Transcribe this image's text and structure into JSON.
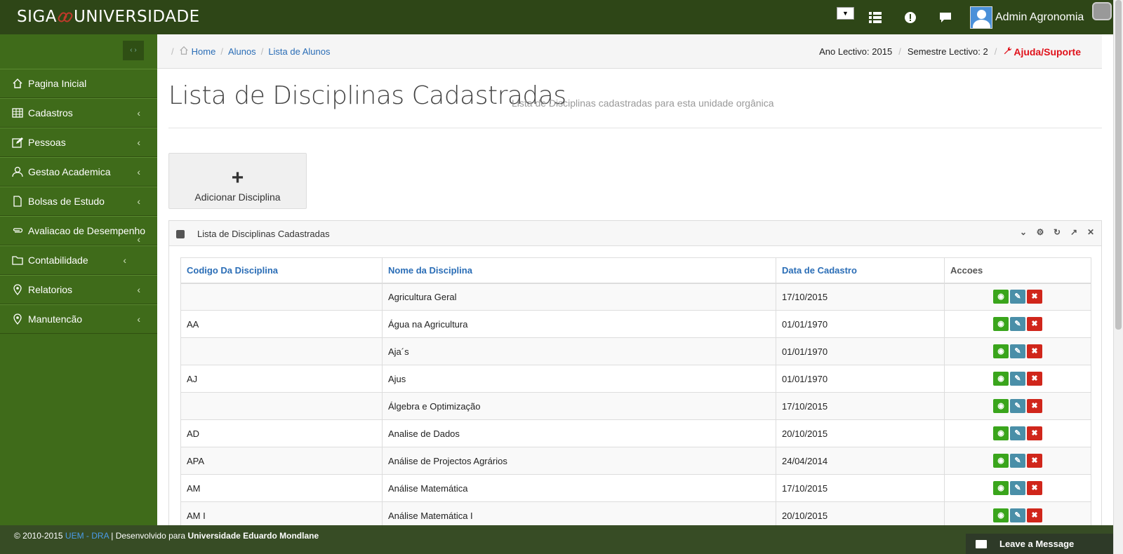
{
  "app": {
    "brand_left": "SIGA",
    "brand_right": "UNIVERSIDADE",
    "user_name": "Admin Agronomia",
    "dropdown_value": "▼"
  },
  "sidebar": {
    "items": [
      {
        "label": "Pagina Inicial",
        "icon": "home-icon"
      },
      {
        "label": "Cadastros",
        "icon": "table-icon"
      },
      {
        "label": "Pessoas",
        "icon": "edit-icon"
      },
      {
        "label": "Gestao Academica",
        "icon": "user-icon"
      },
      {
        "label": "Bolsas de Estudo",
        "icon": "file-icon"
      },
      {
        "label": "Avaliacao de Desempenho",
        "icon": "paperclip-icon"
      },
      {
        "label": "Contabilidade",
        "icon": "folder-icon"
      },
      {
        "label": "Relatorios",
        "icon": "map-pin-icon"
      },
      {
        "label": "Manutencão",
        "icon": "map-pin-icon"
      }
    ]
  },
  "breadcrumb": {
    "home": "Home",
    "alunos": "Alunos",
    "lista": "Lista de Alunos"
  },
  "period": {
    "ano": "Ano Lectivo: 2015",
    "semestre": "Semestre Lectivo: 2",
    "help": "Ajuda/Suporte"
  },
  "page": {
    "title": "Lista de Disciplinas Cadastradas",
    "subtitle": "Lista de Disciplinas cadastradas para esta unidade orgânica",
    "add_button": "Adicionar Disciplina"
  },
  "panel": {
    "title": "Lista de Disciplinas Cadastradas",
    "columns": [
      "Codigo Da Disciplina",
      "Nome da Disciplina",
      "Data de Cadastro",
      "Accoes"
    ],
    "rows": [
      {
        "codigo": "",
        "nome": "Agricultura Geral",
        "data": "17/10/2015"
      },
      {
        "codigo": "AA",
        "nome": "Água na Agricultura",
        "data": "01/01/1970"
      },
      {
        "codigo": "",
        "nome": "Aja´s",
        "data": "01/01/1970"
      },
      {
        "codigo": "AJ",
        "nome": "Ajus",
        "data": "01/01/1970"
      },
      {
        "codigo": "",
        "nome": "Álgebra e Optimização",
        "data": "17/10/2015"
      },
      {
        "codigo": "AD",
        "nome": "Analise de Dados",
        "data": "20/10/2015"
      },
      {
        "codigo": "APA",
        "nome": "Análise de Projectos Agrários",
        "data": "24/04/2014"
      },
      {
        "codigo": "AM",
        "nome": "Análise Matemática",
        "data": "17/10/2015"
      },
      {
        "codigo": "AM I",
        "nome": "Análise Matemática I",
        "data": "20/10/2015"
      }
    ]
  },
  "footer": {
    "copyright": "© 2010-2015",
    "org": "UEM - DRA",
    "dev": "| Desenvolvido para",
    "univ": "Universidade Eduardo Mondlane",
    "leave_message": "Leave a Message"
  }
}
